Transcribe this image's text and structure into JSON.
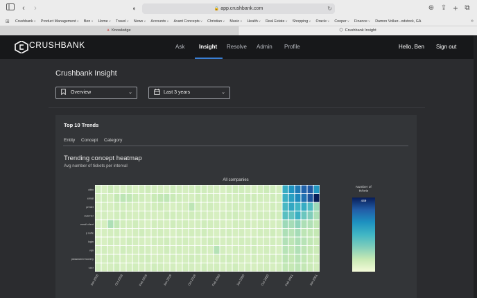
{
  "browser": {
    "url": "app.crushbank.com",
    "bookmarks": [
      {
        "label": "Crushbank",
        "menu": true
      },
      {
        "label": "Product Management",
        "menu": true
      },
      {
        "label": "Ben",
        "menu": true
      },
      {
        "label": "Home",
        "menu": true
      },
      {
        "label": "Travel",
        "menu": true
      },
      {
        "label": "News",
        "menu": true
      },
      {
        "label": "Accounts",
        "menu": true
      },
      {
        "label": "Avant Concepts",
        "menu": true
      },
      {
        "label": "Christian",
        "menu": true
      },
      {
        "label": "Music",
        "menu": true
      },
      {
        "label": "Health",
        "menu": true
      },
      {
        "label": "Real Estate",
        "menu": true
      },
      {
        "label": "Shopping",
        "menu": true
      },
      {
        "label": "Oracle",
        "menu": true
      },
      {
        "label": "Cooper",
        "menu": true
      },
      {
        "label": "Finance",
        "menu": true
      },
      {
        "label": "Damon Volker...odstock, GA",
        "menu": false
      }
    ],
    "tabs": [
      {
        "label": "Knowledge"
      },
      {
        "label": "Crushbank Insight"
      }
    ]
  },
  "app": {
    "logo_text": "CRUSHBANK",
    "nav": [
      "Ask",
      "Insight",
      "Resolve",
      "Admin",
      "Profile"
    ],
    "active_nav": "Insight",
    "greeting": "Hello, Ben",
    "signout": "Sign out"
  },
  "page": {
    "title": "Crushbank Insight",
    "view_select": "Overview",
    "range_select": "Last 3 years"
  },
  "card": {
    "title": "Top 10 Trends",
    "subtabs": [
      "Entity",
      "Concept",
      "Category"
    ],
    "heatmap_title": "Trending concept heatmap",
    "heatmap_subtitle": "Avg number of tickets per interval"
  },
  "chart_data": {
    "type": "heatmap",
    "title": "All companies",
    "rows": [
      "citrix",
      "email",
      "printer",
      "scanner",
      "email client",
      "p suite",
      "login",
      "vpn",
      "password recovery",
      "user"
    ],
    "x_tick_labels": [
      "Jun 2018",
      "Oct 2018",
      "Feb 2019",
      "Jun 2019",
      "Oct 2019",
      "Feb 2020",
      "Jun 2020",
      "Oct 2020",
      "Feb 2021",
      "Jun 2021"
    ],
    "columns": 36,
    "colorbar_title": "Number of tickets",
    "colorbar_max_label": "449",
    "colorscale": [
      "#f4fad9",
      "#c7e9b4",
      "#7fcdbb",
      "#41b6c4",
      "#1d91c0",
      "#225ea8",
      "#081d58"
    ],
    "values": [
      [
        12,
        8,
        14,
        10,
        9,
        12,
        7,
        11,
        13,
        10,
        9,
        8,
        12,
        10,
        9,
        11,
        14,
        12,
        10,
        9,
        8,
        11,
        13,
        12,
        10,
        9,
        11,
        14,
        12,
        10,
        150,
        210,
        260,
        310,
        330,
        200
      ],
      [
        10,
        12,
        9,
        18,
        22,
        20,
        14,
        12,
        10,
        16,
        19,
        21,
        15,
        12,
        10,
        9,
        13,
        11,
        12,
        10,
        9,
        11,
        10,
        12,
        14,
        13,
        11,
        10,
        12,
        11,
        140,
        180,
        230,
        280,
        340,
        449
      ],
      [
        8,
        10,
        9,
        12,
        11,
        10,
        9,
        8,
        10,
        11,
        13,
        9,
        8,
        10,
        9,
        22,
        11,
        10,
        12,
        9,
        8,
        10,
        11,
        9,
        12,
        10,
        9,
        8,
        11,
        10,
        120,
        160,
        130,
        150,
        110,
        40
      ],
      [
        9,
        10,
        8,
        11,
        12,
        10,
        9,
        11,
        10,
        9,
        8,
        12,
        11,
        10,
        9,
        12,
        11,
        10,
        9,
        8,
        10,
        11,
        12,
        9,
        10,
        9,
        11,
        10,
        12,
        11,
        100,
        90,
        140,
        80,
        60,
        30
      ],
      [
        10,
        9,
        30,
        20,
        11,
        10,
        12,
        9,
        8,
        11,
        10,
        9,
        12,
        10,
        11,
        9,
        10,
        12,
        11,
        10,
        9,
        8,
        11,
        10,
        12,
        9,
        10,
        11,
        9,
        10,
        40,
        35,
        50,
        30,
        28,
        20
      ],
      [
        8,
        9,
        10,
        11,
        9,
        8,
        10,
        12,
        9,
        10,
        11,
        9,
        8,
        10,
        9,
        11,
        10,
        12,
        9,
        8,
        10,
        11,
        9,
        10,
        8,
        9,
        11,
        10,
        12,
        9,
        30,
        25,
        35,
        22,
        20,
        18
      ],
      [
        9,
        8,
        11,
        10,
        9,
        12,
        10,
        9,
        8,
        11,
        10,
        12,
        9,
        10,
        11,
        9,
        8,
        10,
        12,
        11,
        9,
        10,
        8,
        11,
        10,
        12,
        9,
        10,
        11,
        9,
        28,
        22,
        30,
        25,
        20,
        15
      ],
      [
        10,
        11,
        9,
        8,
        12,
        10,
        9,
        11,
        10,
        8,
        9,
        12,
        10,
        11,
        9,
        10,
        12,
        11,
        9,
        26,
        10,
        8,
        11,
        9,
        10,
        12,
        9,
        11,
        10,
        8,
        25,
        20,
        28,
        22,
        18,
        14
      ],
      [
        9,
        10,
        12,
        11,
        9,
        8,
        10,
        11,
        12,
        9,
        10,
        8,
        11,
        9,
        10,
        12,
        11,
        9,
        8,
        10,
        11,
        12,
        9,
        10,
        8,
        11,
        9,
        10,
        12,
        11,
        22,
        18,
        24,
        20,
        16,
        12
      ],
      [
        11,
        9,
        10,
        12,
        8,
        10,
        11,
        9,
        10,
        12,
        11,
        9,
        10,
        8,
        11,
        10,
        9,
        12,
        10,
        11,
        9,
        10,
        12,
        8,
        11,
        9,
        10,
        11,
        9,
        10,
        20,
        18,
        22,
        19,
        15,
        11
      ]
    ],
    "value_max": 449
  },
  "icons": {
    "sidebar": "sidebar-icon",
    "back": "chevron-left-icon",
    "forward": "chevron-right-icon",
    "shield": "shield-icon",
    "download": "download-icon",
    "share": "share-icon",
    "new_tab": "plus-icon",
    "tabs": "tabs-icon",
    "bookmark_view": "bookmark-icon",
    "calendar": "calendar-icon",
    "chevron": "chevron-down-icon"
  }
}
